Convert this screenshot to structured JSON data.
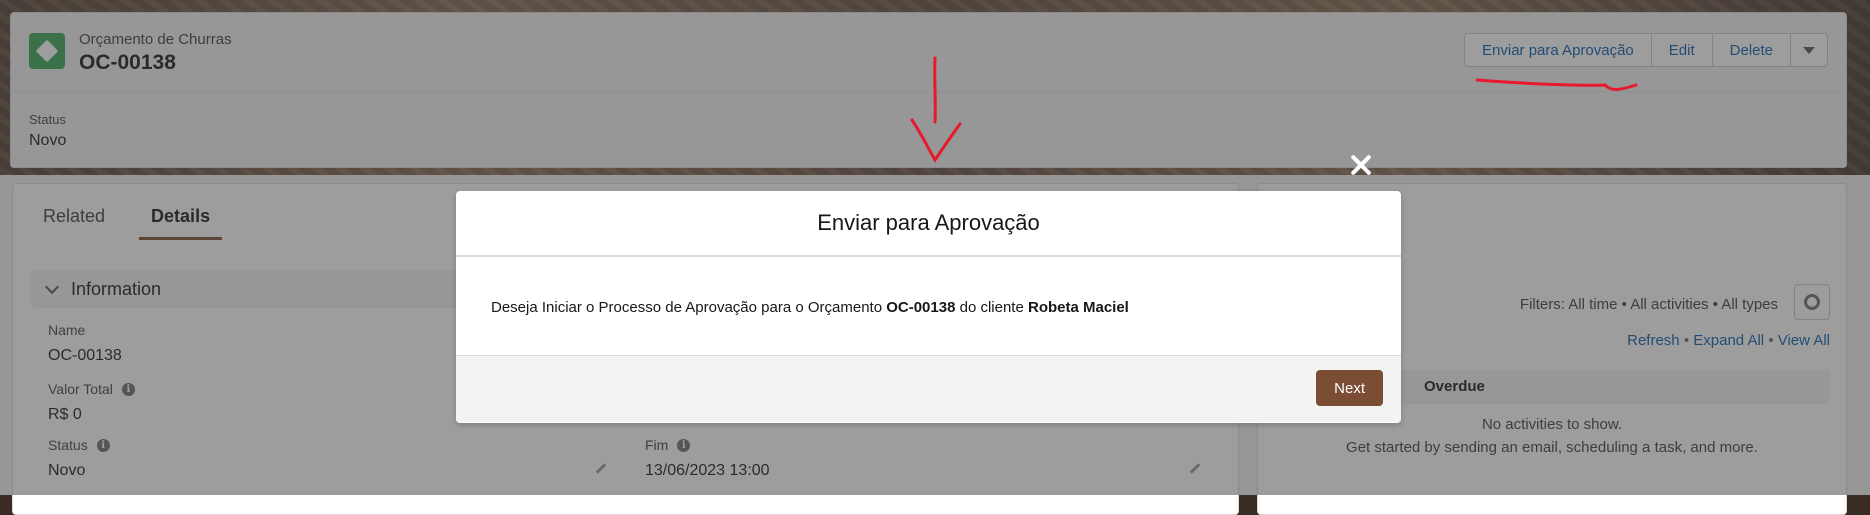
{
  "record": {
    "object_label": "Orçamento de Churras",
    "name": "OC-00138",
    "actions": [
      "Enviar para Aprovação",
      "Edit",
      "Delete"
    ],
    "menu_icon": "chevron-down-icon",
    "highlight_field": {
      "label": "Status",
      "value": "Novo"
    }
  },
  "tabs": [
    {
      "label": "Related",
      "active": false
    },
    {
      "label": "Details",
      "active": true
    }
  ],
  "section": {
    "title": "Information"
  },
  "fields": {
    "name": {
      "label": "Name",
      "value": "OC-00138"
    },
    "valor_total": {
      "label": "Valor Total",
      "value": "R$ 0"
    },
    "status": {
      "label": "Status",
      "value": "Novo"
    },
    "fim": {
      "label": "Fim",
      "value": "13/06/2023 13:00"
    }
  },
  "activity": {
    "filters": "Filters: All time • All activities • All types",
    "links": [
      "Refresh",
      "Expand All",
      "View All"
    ],
    "overdue_label": "Overdue",
    "empty_title": "No activities to show.",
    "empty_sub": "Get started by sending an email, scheduling a task, and more."
  },
  "modal": {
    "title": "Enviar para Aprovação",
    "message_prefix": "Deseja Iniciar o Processo de Aprovação para o Orçamento ",
    "record_name": "OC-00138",
    "message_middle": " do cliente ",
    "client_name": "Robeta Maciel",
    "next_label": "Next"
  },
  "colors": {
    "brand": "#7a4d34",
    "record_icon": "#3ba755",
    "annotation": "#e8192c"
  }
}
